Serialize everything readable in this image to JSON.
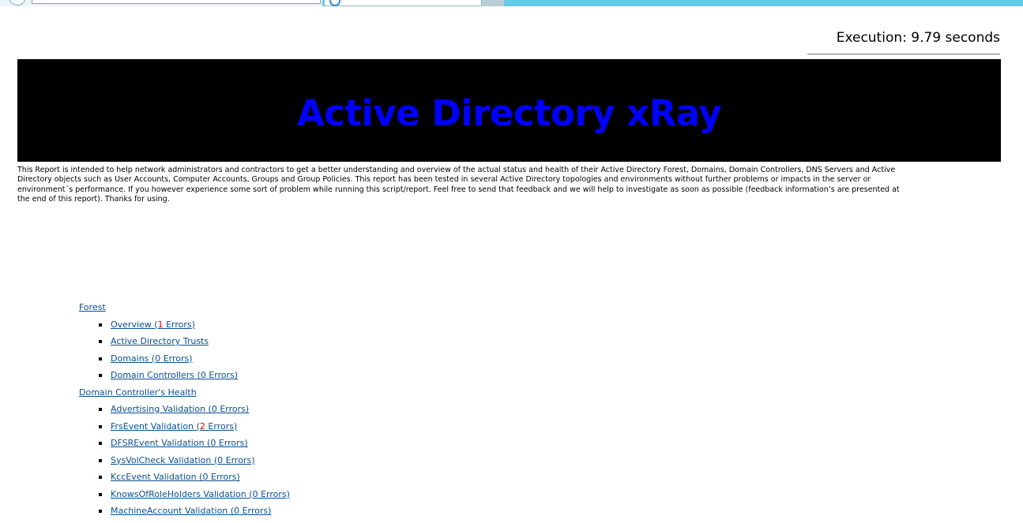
{
  "header": {
    "execution_text": "Execution: 9.79 seconds"
  },
  "banner": {
    "title": "Active Directory xRay",
    "title_color": "#0000ff",
    "background": "#000000"
  },
  "intro": {
    "text": "This Report is intended to help network administrators and contractors to get a better understanding and overview of the actual status and health of their Active Directory Forest, Domains, Domain Controllers, DNS Servers and Active Directory objects such as User Accounts, Computer Accounts, Groups and Group Policies. This report has been tested in several Active Directory topologies and environments without further problems or impacts in the server or environment´s performance. If you however experience some sort of problem while running this script/report. Feel free to send that feedback and we will help to investigate as soon as possible (feedback information’s are presented at the end of this report). Thanks for using."
  },
  "toc": {
    "sections": [
      {
        "label": "Forest",
        "items": [
          {
            "label": "Overview",
            "count": "1",
            "suffix": "Errors",
            "has_error": true
          },
          {
            "label": "Active Directory Trusts"
          },
          {
            "label": "Domains",
            "count": "0",
            "suffix": "Errors",
            "has_error": false
          },
          {
            "label": "Domain Controllers",
            "count": "0",
            "suffix": "Errors",
            "has_error": false
          }
        ]
      },
      {
        "label": "Domain Controller's Health",
        "items": [
          {
            "label": "Advertising Validation",
            "count": "0",
            "suffix": "Errors",
            "has_error": false
          },
          {
            "label": "FrsEvent Validation",
            "count": "2",
            "suffix": "Errors",
            "has_error": true
          },
          {
            "label": "DFSREvent Validation",
            "count": "0",
            "suffix": "Errors",
            "has_error": false
          },
          {
            "label": "SysVolCheck Validation",
            "count": "0",
            "suffix": "Errors",
            "has_error": false
          },
          {
            "label": "KccEvent Validation",
            "count": "0",
            "suffix": "Errors",
            "has_error": false
          },
          {
            "label": "KnowsOfRoleHolders Validation",
            "count": "0",
            "suffix": "Errors",
            "has_error": false
          },
          {
            "label": "MachineAccount Validation",
            "count": "0",
            "suffix": "Errors",
            "has_error": false
          }
        ]
      }
    ],
    "link_color": "#0a4f8f",
    "error_color": "#e00000"
  }
}
